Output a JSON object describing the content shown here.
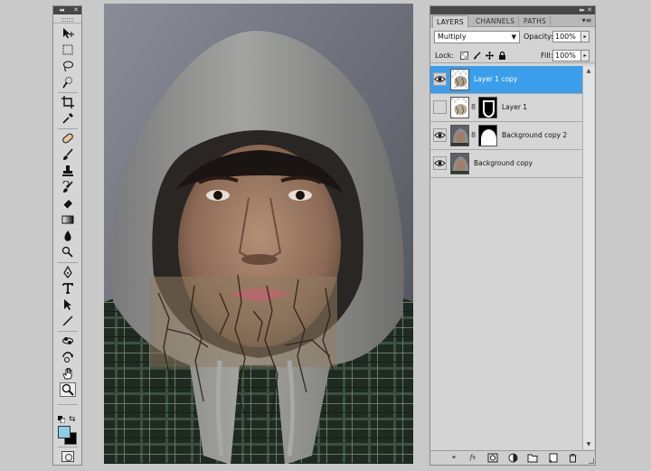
{
  "layers_panel": {
    "tabs": [
      {
        "label": "LAYERS",
        "active": true
      },
      {
        "label": "CHANNELS",
        "active": false
      },
      {
        "label": "PATHS",
        "active": false
      }
    ],
    "blend_mode": "Multiply",
    "opacity_label": "Opacity:",
    "opacity_value": "100%",
    "lock_label": "Lock:",
    "fill_label": "Fill:",
    "fill_value": "100%",
    "layers": [
      {
        "name": "Layer 1 copy",
        "visible": true,
        "selected": true,
        "has_mask": false
      },
      {
        "name": "Layer 1",
        "visible": false,
        "selected": false,
        "has_mask": true
      },
      {
        "name": "Background copy 2",
        "visible": true,
        "selected": false,
        "has_mask": true
      },
      {
        "name": "Background copy",
        "visible": true,
        "selected": false,
        "has_mask": false
      }
    ],
    "footer_icons": [
      "link-layers-icon",
      "fx-icon",
      "add-mask-icon",
      "adjustment-layer-icon",
      "new-group-icon",
      "new-layer-icon",
      "trash-icon"
    ]
  },
  "toolbox": {
    "tools": [
      "move",
      "marquee",
      "lasso",
      "quick-selection",
      "crop",
      "eyedropper",
      "healing-brush",
      "brush",
      "clone-stamp",
      "history-brush",
      "eraser",
      "gradient",
      "blur",
      "dodge",
      "pen",
      "type",
      "path-selection",
      "line",
      "3d-rotate",
      "3d-orbit",
      "hand",
      "zoom"
    ],
    "selected_tool": "zoom",
    "foreground_color": "#8ecbea",
    "background_color": "#000000"
  },
  "canvas": {
    "description_colors": {
      "backdrop": "#6d6e78",
      "hood": "#8d8e8c",
      "shirt": "#263426"
    }
  }
}
